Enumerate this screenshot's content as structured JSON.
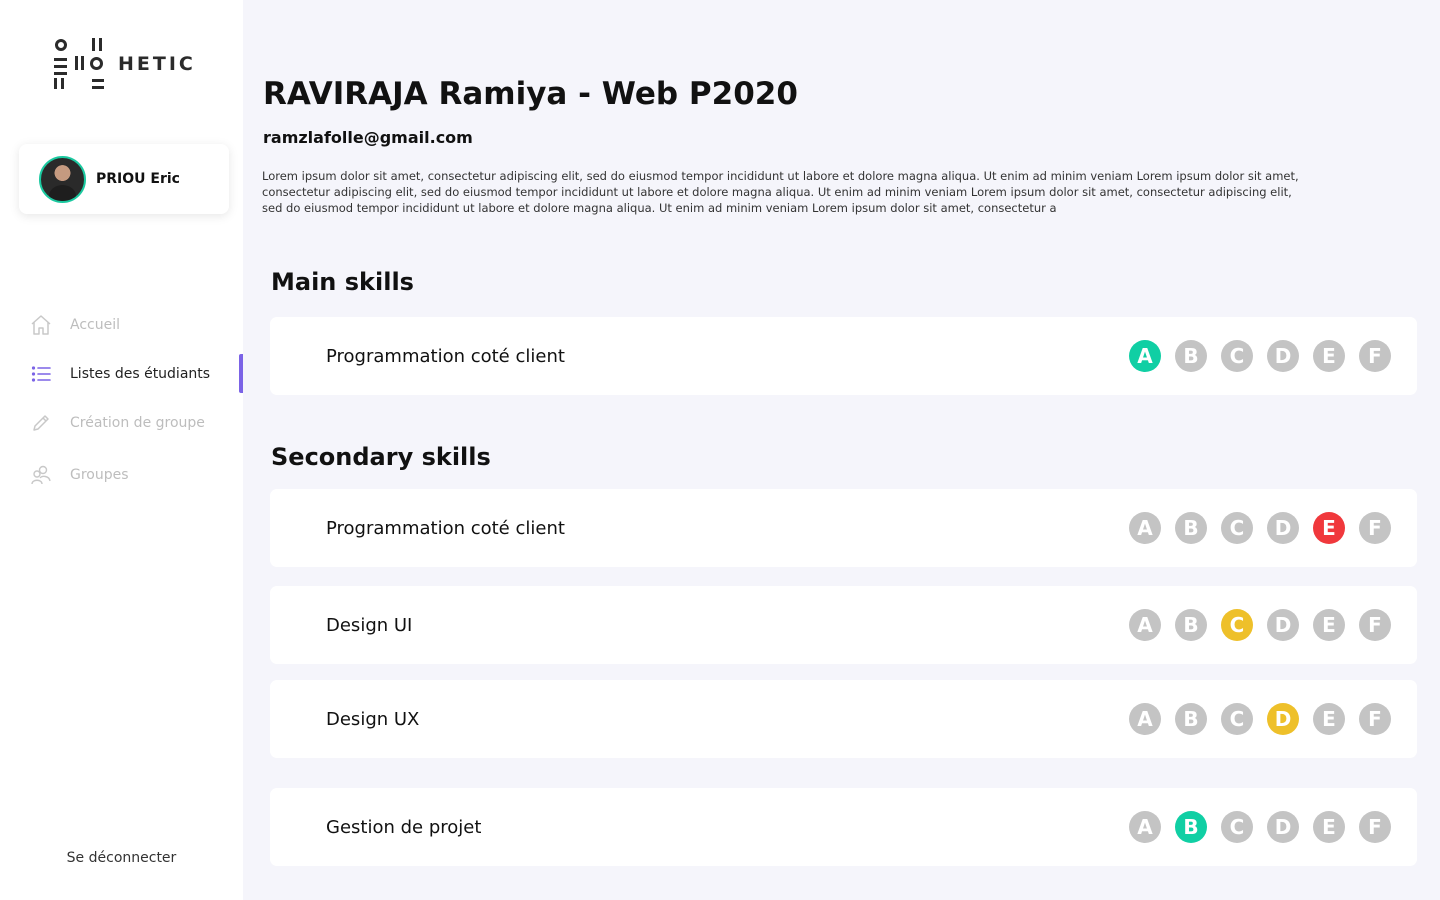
{
  "brand": {
    "name": "HETIC"
  },
  "user": {
    "name": "PRIOU Eric"
  },
  "nav": [
    {
      "label": "Accueil",
      "icon": "home-icon",
      "active": false
    },
    {
      "label": "Listes des étudiants",
      "icon": "list-icon",
      "active": true
    },
    {
      "label": "Création de groupe",
      "icon": "pencil-icon",
      "active": false
    },
    {
      "label": "Groupes",
      "icon": "group-icon",
      "active": false
    }
  ],
  "logout_label": "Se déconnecter",
  "student": {
    "last_name": "RAVIRAJA",
    "first_name": "Ramiya",
    "separator": "-",
    "program": "Web",
    "promo": "P2020",
    "email": "ramzlafolle@gmail.com",
    "description": "Lorem ipsum dolor sit amet, consectetur adipiscing elit, sed do eiusmod tempor incididunt ut labore et dolore magna aliqua. Ut enim ad minim veniam Lorem ipsum dolor sit amet, consectetur adipiscing elit, sed do eiusmod tempor incididunt ut labore et dolore magna aliqua. Ut enim ad minim veniam Lorem ipsum dolor sit amet, consectetur adipiscing elit, sed do eiusmod tempor incididunt ut labore et dolore magna aliqua. Ut enim ad minim veniam Lorem ipsum dolor sit amet, consectetur a"
  },
  "grade_letters": [
    "A",
    "B",
    "C",
    "D",
    "E",
    "F"
  ],
  "colors": {
    "accent": "#7b63e6",
    "green": "#10cfa4",
    "red": "#f0383c",
    "yellow": "#eec02a",
    "grey": "#c4c4c4"
  },
  "main_skills": {
    "title": "Main skills",
    "items": [
      {
        "name": "Programmation coté client",
        "grade": "A",
        "color": "green"
      }
    ]
  },
  "secondary_skills": {
    "title": "Secondary skills",
    "items": [
      {
        "name": "Programmation coté client",
        "grade": "E",
        "color": "red"
      },
      {
        "name": "Design UI",
        "grade": "C",
        "color": "yellow"
      },
      {
        "name": "Design UX",
        "grade": "D",
        "color": "yellow"
      },
      {
        "name": "Gestion de projet",
        "grade": "B",
        "color": "green"
      }
    ]
  }
}
